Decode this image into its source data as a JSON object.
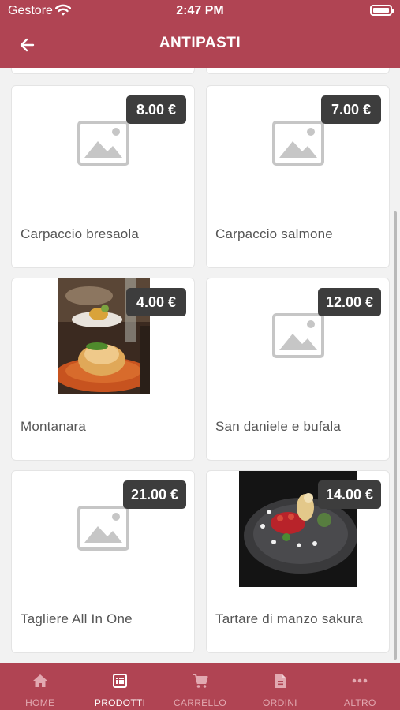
{
  "status_bar": {
    "carrier": "Gestore",
    "time": "2:47 PM"
  },
  "header": {
    "title": "ANTIPASTI"
  },
  "products": [
    {
      "name": "Carpaccio bresaola",
      "price": "8.00 €",
      "image": "placeholder-icon"
    },
    {
      "name": "Carpaccio salmone",
      "price": "7.00 €",
      "image": "placeholder-icon"
    },
    {
      "name": "Montanara",
      "price": "4.00 €",
      "image": "montanara-photo"
    },
    {
      "name": "San daniele e bufala",
      "price": "12.00 €",
      "image": "placeholder-icon"
    },
    {
      "name": "Tagliere All In One",
      "price": "21.00 €",
      "image": "placeholder-icon"
    },
    {
      "name": "Tartare di manzo sakura",
      "price": "14.00 €",
      "image": "tartare-photo"
    }
  ],
  "tabs": [
    {
      "label": "HOME",
      "icon": "home-icon",
      "active": false
    },
    {
      "label": "PRODOTTI",
      "icon": "list-icon",
      "active": true
    },
    {
      "label": "CARRELLO",
      "icon": "cart-icon",
      "active": false
    },
    {
      "label": "ORDINI",
      "icon": "document-icon",
      "active": false
    },
    {
      "label": "ALTRO",
      "icon": "more-icon",
      "active": false
    }
  ],
  "colors": {
    "brand": "#b04453",
    "price_badge": "#3d3d3d",
    "tab_active": "#ffffff",
    "tab_inactive": "#e2a9b1",
    "placeholder": "#c6c6c6"
  }
}
